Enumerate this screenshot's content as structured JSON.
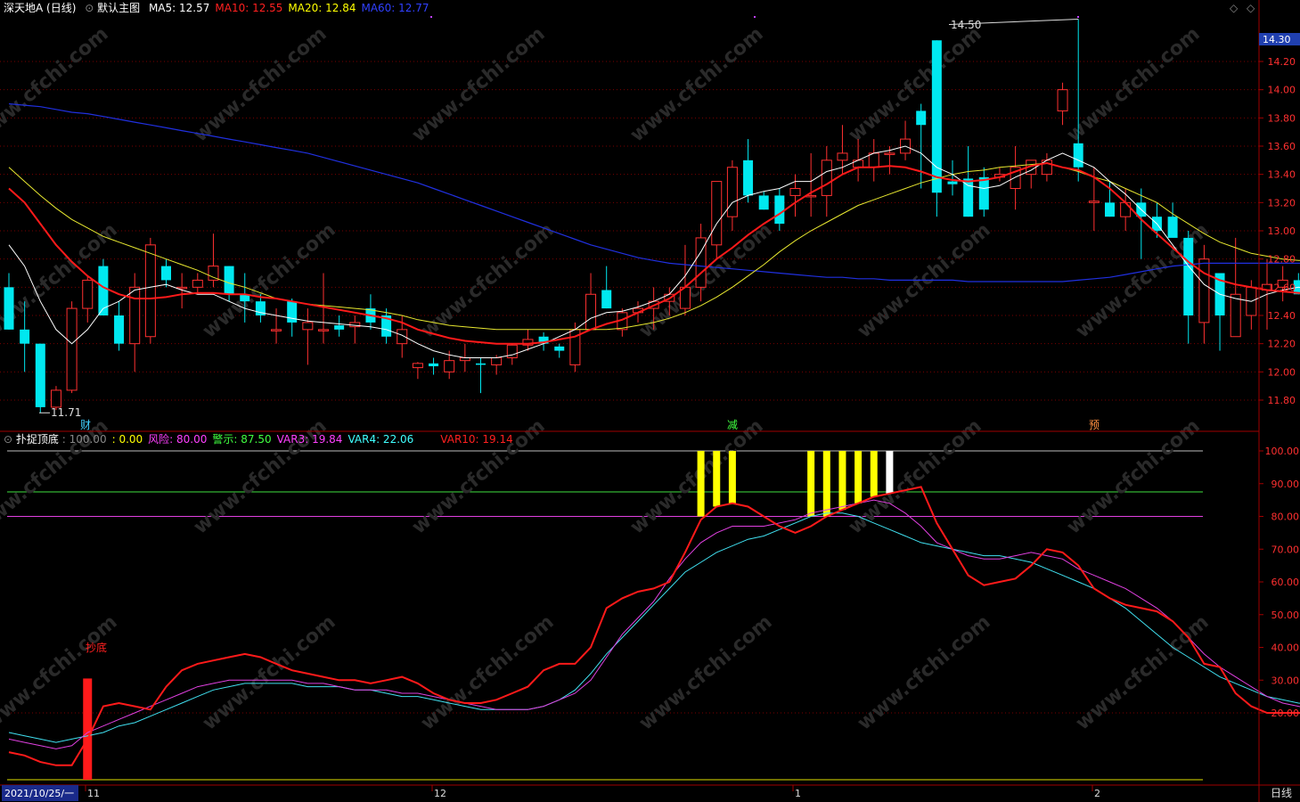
{
  "header": {
    "title": "深天地A (日线)",
    "main_chart_label": "默认主图",
    "ma": [
      {
        "label": "MA5: 12.57",
        "color": "#ffffff"
      },
      {
        "label": "MA10: 12.55",
        "color": "#ff2020"
      },
      {
        "label": "MA20: 12.84",
        "color": "#ffff00"
      },
      {
        "label": "MA60: 12.77",
        "color": "#3040ff"
      }
    ]
  },
  "sub_header": {
    "title": "扑捉顶底",
    "items": [
      {
        "label": ": 100.00",
        "color": "#888888"
      },
      {
        "label": ": 0.00",
        "color": "#ffff00"
      },
      {
        "label": "风险: 80.00",
        "color": "#ff40ff"
      },
      {
        "label": "警示: 87.50",
        "color": "#40ff40"
      },
      {
        "label": "VAR3: 19.84",
        "color": "#ff40ff"
      },
      {
        "label": "VAR4: 22.06",
        "color": "#40ffff"
      },
      {
        "label": "VAR10: 19.14",
        "color": "#ff2020"
      }
    ]
  },
  "price_axis": {
    "ticks": [
      "14.20",
      "14.00",
      "13.80",
      "13.60",
      "13.40",
      "13.20",
      "13.00",
      "12.80",
      "12.60",
      "12.40",
      "12.20",
      "12.00",
      "11.80"
    ],
    "current": "14.30"
  },
  "ind_axis": {
    "ticks": [
      "100.00",
      "90.00",
      "80.00",
      "70.00",
      "60.00",
      "50.00",
      "40.00",
      "30.00",
      "20.00"
    ]
  },
  "markers": {
    "high_label": "14.50",
    "low_label": "11.71",
    "cai": "财",
    "jian": "减",
    "yu": "预",
    "chaodi": "抄底"
  },
  "date_axis": {
    "start": "2021/10/25/一",
    "labels": [
      "11",
      "12",
      "1",
      "2"
    ],
    "period": "日线"
  },
  "watermark": "www.cfchi.com",
  "colors": {
    "up": "#ff3030",
    "down": "#00e8f0",
    "bg": "#000000",
    "grid": "#7a0000"
  },
  "chart_data": {
    "type": "candlestick",
    "candles": [
      [
        12.6,
        12.7,
        12.3,
        12.3
      ],
      [
        12.3,
        12.5,
        12.0,
        12.2
      ],
      [
        12.2,
        12.2,
        11.71,
        11.75
      ],
      [
        11.75,
        11.9,
        11.73,
        11.87
      ],
      [
        11.87,
        12.5,
        11.85,
        12.45
      ],
      [
        12.45,
        12.68,
        12.35,
        12.65
      ],
      [
        12.75,
        12.8,
        12.45,
        12.4
      ],
      [
        12.4,
        12.5,
        12.15,
        12.2
      ],
      [
        12.2,
        12.7,
        12.0,
        12.6
      ],
      [
        12.25,
        12.95,
        12.2,
        12.9
      ],
      [
        12.75,
        12.8,
        12.6,
        12.65
      ],
      [
        12.6,
        12.7,
        12.45,
        12.6
      ],
      [
        12.6,
        12.7,
        12.55,
        12.65
      ],
      [
        12.65,
        12.98,
        12.6,
        12.75
      ],
      [
        12.75,
        12.75,
        12.5,
        12.55
      ],
      [
        12.55,
        12.7,
        12.35,
        12.5
      ],
      [
        12.5,
        12.55,
        12.35,
        12.4
      ],
      [
        12.3,
        12.45,
        12.2,
        12.3
      ],
      [
        12.5,
        12.52,
        12.25,
        12.35
      ],
      [
        12.3,
        12.45,
        12.05,
        12.35
      ],
      [
        12.3,
        12.7,
        12.2,
        12.3
      ],
      [
        12.33,
        12.4,
        12.25,
        12.3
      ],
      [
        12.32,
        12.4,
        12.2,
        12.35
      ],
      [
        12.45,
        12.55,
        12.3,
        12.35
      ],
      [
        12.4,
        12.45,
        12.2,
        12.25
      ],
      [
        12.2,
        12.4,
        12.1,
        12.3
      ],
      [
        12.03,
        12.07,
        11.95,
        12.06
      ],
      [
        12.06,
        12.1,
        11.98,
        12.04
      ],
      [
        12.0,
        12.15,
        11.95,
        12.08
      ],
      [
        12.08,
        12.2,
        12.0,
        12.1
      ],
      [
        12.06,
        12.1,
        11.85,
        12.05
      ],
      [
        12.05,
        12.12,
        11.98,
        12.1
      ],
      [
        12.1,
        12.2,
        12.05,
        12.19
      ],
      [
        12.19,
        12.3,
        12.15,
        12.23
      ],
      [
        12.25,
        12.28,
        12.15,
        12.2
      ],
      [
        12.18,
        12.2,
        12.1,
        12.15
      ],
      [
        12.05,
        12.35,
        12.0,
        12.3
      ],
      [
        12.3,
        12.7,
        12.3,
        12.55
      ],
      [
        12.58,
        12.75,
        12.45,
        12.45
      ],
      [
        12.3,
        12.45,
        12.25,
        12.42
      ],
      [
        12.42,
        12.5,
        12.35,
        12.45
      ],
      [
        12.45,
        12.6,
        12.3,
        12.5
      ],
      [
        12.5,
        12.6,
        12.4,
        12.55
      ],
      [
        12.45,
        12.9,
        12.4,
        12.6
      ],
      [
        12.6,
        13.05,
        12.5,
        12.95
      ],
      [
        12.9,
        13.25,
        12.8,
        13.35
      ],
      [
        13.1,
        13.5,
        13.0,
        13.45
      ],
      [
        13.5,
        13.65,
        13.2,
        13.25
      ],
      [
        13.25,
        13.28,
        13.15,
        13.15
      ],
      [
        13.25,
        13.3,
        13.0,
        13.05
      ],
      [
        13.25,
        13.4,
        13.1,
        13.3
      ],
      [
        13.25,
        13.55,
        13.1,
        13.25
      ],
      [
        13.25,
        13.6,
        13.1,
        13.5
      ],
      [
        13.5,
        13.75,
        13.4,
        13.55
      ],
      [
        13.45,
        13.65,
        13.35,
        13.5
      ],
      [
        13.45,
        13.65,
        13.35,
        13.55
      ],
      [
        13.55,
        13.6,
        13.4,
        13.55
      ],
      [
        13.55,
        13.78,
        13.5,
        13.65
      ],
      [
        13.85,
        13.9,
        13.3,
        13.75
      ],
      [
        14.35,
        14.35,
        13.1,
        13.27
      ],
      [
        13.35,
        13.5,
        13.25,
        13.33
      ],
      [
        13.37,
        13.6,
        13.1,
        13.1
      ],
      [
        13.38,
        13.45,
        13.1,
        13.15
      ],
      [
        13.38,
        13.45,
        13.35,
        13.4
      ],
      [
        13.3,
        13.6,
        13.15,
        13.45
      ],
      [
        13.4,
        13.5,
        13.3,
        13.5
      ],
      [
        13.4,
        13.55,
        13.35,
        13.5
      ],
      [
        13.85,
        14.05,
        13.75,
        14.0
      ],
      [
        13.62,
        14.5,
        13.35,
        13.45
      ],
      [
        13.2,
        13.45,
        13.0,
        13.21
      ],
      [
        13.2,
        13.35,
        13.1,
        13.1
      ],
      [
        13.1,
        13.3,
        13.0,
        13.2
      ],
      [
        13.2,
        13.3,
        12.8,
        13.1
      ],
      [
        13.1,
        13.2,
        12.95,
        13.0
      ],
      [
        13.1,
        13.2,
        13.0,
        12.95
      ],
      [
        12.95,
        13.0,
        12.2,
        12.4
      ],
      [
        12.35,
        12.9,
        12.2,
        12.8
      ],
      [
        12.7,
        12.7,
        12.15,
        12.4
      ],
      [
        12.25,
        12.95,
        12.25,
        12.55
      ],
      [
        12.4,
        12.65,
        12.3,
        12.6
      ],
      [
        12.58,
        12.8,
        12.3,
        12.62
      ],
      [
        12.6,
        12.75,
        12.5,
        12.65
      ],
      [
        12.65,
        12.7,
        12.55,
        12.55
      ],
      [
        12.55,
        12.6,
        12.45,
        12.6
      ],
      [
        12.45,
        12.65,
        12.4,
        12.55
      ],
      [
        12.55,
        12.7,
        12.45,
        12.5
      ],
      [
        12.55,
        12.65,
        12.45,
        12.65
      ]
    ],
    "ma5": [
      12.9,
      12.75,
      12.5,
      12.3,
      12.2,
      12.3,
      12.45,
      12.5,
      12.58,
      12.6,
      12.62,
      12.58,
      12.55,
      12.55,
      12.5,
      12.45,
      12.42,
      12.4,
      12.38,
      12.36,
      12.35,
      12.34,
      12.33,
      12.32,
      12.3,
      12.26,
      12.2,
      12.15,
      12.12,
      12.1,
      12.1,
      12.1,
      12.12,
      12.16,
      12.2,
      12.25,
      12.3,
      12.38,
      12.42,
      12.43,
      12.46,
      12.5,
      12.55,
      12.68,
      12.85,
      13.05,
      13.2,
      13.25,
      13.28,
      13.3,
      13.35,
      13.35,
      13.42,
      13.45,
      13.5,
      13.55,
      13.57,
      13.6,
      13.55,
      13.45,
      13.4,
      13.32,
      13.3,
      13.32,
      13.38,
      13.43,
      13.5,
      13.55,
      13.5,
      13.45,
      13.35,
      13.26,
      13.15,
      13.05,
      12.9,
      12.75,
      12.62,
      12.55,
      12.52,
      12.5,
      12.55,
      12.58,
      12.6,
      12.58,
      12.58,
      12.57,
      12.57
    ],
    "ma10": [
      13.3,
      13.2,
      13.05,
      12.9,
      12.78,
      12.68,
      12.6,
      12.55,
      12.52,
      12.52,
      12.53,
      12.55,
      12.56,
      12.56,
      12.55,
      12.55,
      12.53,
      12.52,
      12.5,
      12.48,
      12.46,
      12.44,
      12.42,
      12.4,
      12.38,
      12.35,
      12.3,
      12.27,
      12.24,
      12.22,
      12.21,
      12.2,
      12.2,
      12.2,
      12.21,
      12.23,
      12.25,
      12.3,
      12.34,
      12.37,
      12.42,
      12.47,
      12.52,
      12.6,
      12.7,
      12.8,
      12.88,
      12.97,
      13.05,
      13.12,
      13.2,
      13.27,
      13.33,
      13.4,
      13.45,
      13.45,
      13.46,
      13.45,
      13.42,
      13.38,
      13.36,
      13.35,
      13.36,
      13.38,
      13.42,
      13.46,
      13.48,
      13.45,
      13.43,
      13.38,
      13.3,
      13.2,
      13.08,
      12.98,
      12.88,
      12.78,
      12.7,
      12.65,
      12.62,
      12.6,
      12.58,
      12.57,
      12.56,
      12.55,
      12.55,
      12.55,
      12.55
    ],
    "ma20": [
      13.45,
      13.35,
      13.25,
      13.16,
      13.08,
      13.02,
      12.96,
      12.92,
      12.88,
      12.84,
      12.8,
      12.76,
      12.72,
      12.67,
      12.63,
      12.6,
      12.56,
      12.52,
      12.5,
      12.48,
      12.47,
      12.46,
      12.45,
      12.44,
      12.42,
      12.4,
      12.37,
      12.35,
      12.33,
      12.32,
      12.31,
      12.3,
      12.3,
      12.3,
      12.3,
      12.3,
      12.3,
      12.3,
      12.3,
      12.31,
      12.33,
      12.35,
      12.38,
      12.42,
      12.47,
      12.53,
      12.6,
      12.68,
      12.76,
      12.85,
      12.93,
      13.0,
      13.06,
      13.12,
      13.18,
      13.22,
      13.26,
      13.3,
      13.34,
      13.37,
      13.4,
      13.42,
      13.43,
      13.45,
      13.46,
      13.47,
      13.48,
      13.45,
      13.42,
      13.38,
      13.35,
      13.3,
      13.25,
      13.2,
      13.12,
      13.05,
      12.98,
      12.92,
      12.88,
      12.84,
      12.82,
      12.8,
      12.79,
      12.79,
      12.78,
      12.8,
      12.84
    ],
    "ma60": [
      13.9,
      13.89,
      13.88,
      13.86,
      13.84,
      13.83,
      13.81,
      13.79,
      13.77,
      13.75,
      13.73,
      13.71,
      13.69,
      13.67,
      13.65,
      13.63,
      13.61,
      13.59,
      13.57,
      13.55,
      13.52,
      13.49,
      13.46,
      13.43,
      13.4,
      13.37,
      13.34,
      13.3,
      13.26,
      13.22,
      13.18,
      13.14,
      13.1,
      13.06,
      13.02,
      12.98,
      12.94,
      12.9,
      12.87,
      12.84,
      12.81,
      12.79,
      12.77,
      12.76,
      12.75,
      12.74,
      12.73,
      12.72,
      12.71,
      12.7,
      12.69,
      12.68,
      12.67,
      12.67,
      12.66,
      12.66,
      12.65,
      12.65,
      12.65,
      12.65,
      12.65,
      12.64,
      12.64,
      12.64,
      12.64,
      12.64,
      12.64,
      12.64,
      12.65,
      12.66,
      12.67,
      12.69,
      12.71,
      12.73,
      12.75,
      12.76,
      12.77,
      12.77,
      12.77,
      12.77,
      12.77,
      12.77,
      12.77,
      12.77,
      12.77,
      12.77,
      12.77
    ],
    "var10": [
      8,
      7,
      5,
      4,
      4,
      12,
      22,
      23,
      22,
      21,
      28,
      33,
      35,
      36,
      37,
      38,
      37,
      35,
      33,
      32,
      31,
      30,
      30,
      29,
      30,
      31,
      29,
      26,
      24,
      23,
      23,
      24,
      26,
      28,
      33,
      35,
      35,
      40,
      52,
      55,
      57,
      58,
      60,
      69,
      79,
      83,
      84,
      83,
      80,
      77,
      75,
      77,
      80,
      82,
      84,
      86,
      87,
      88,
      89,
      78,
      70,
      62,
      59,
      60,
      61,
      65,
      70,
      69,
      65,
      58,
      55,
      53,
      52,
      51,
      48,
      43,
      35,
      34,
      26,
      22,
      20,
      20,
      20,
      19.5,
      19,
      18.5,
      18.5,
      19.14
    ],
    "var3": [
      12,
      11,
      10,
      9,
      10,
      14,
      16,
      18,
      20,
      22,
      24,
      26,
      28,
      29,
      30,
      30,
      30,
      30,
      30,
      29,
      29,
      28,
      27,
      27,
      27,
      26,
      26,
      25,
      24,
      23,
      22,
      21,
      21,
      21,
      22,
      24,
      26,
      30,
      37,
      44,
      49,
      54,
      61,
      67,
      72,
      75,
      77,
      77,
      77,
      78,
      79,
      81,
      82,
      83,
      84,
      85,
      84,
      81,
      77,
      72,
      70,
      68,
      67,
      67,
      68,
      69,
      68,
      67,
      64,
      62,
      60,
      58,
      55,
      52,
      48,
      43,
      38,
      34,
      31,
      28,
      25,
      23,
      22,
      21,
      20.5,
      20,
      19.84
    ],
    "var4": [
      14,
      13,
      12,
      11,
      12,
      13,
      14,
      16,
      17,
      19,
      21,
      23,
      25,
      27,
      28,
      29,
      29,
      29,
      29,
      28,
      28,
      28,
      27,
      27,
      26,
      25,
      25,
      24,
      23,
      22,
      21,
      21,
      21,
      21,
      22,
      24,
      27,
      32,
      38,
      43,
      48,
      53,
      58,
      63,
      66,
      69,
      71,
      73,
      74,
      76,
      78,
      80,
      81,
      81,
      80,
      78,
      76,
      74,
      72,
      71,
      70,
      69,
      68,
      68,
      67,
      66,
      64,
      62,
      60,
      58,
      55,
      52,
      48,
      44,
      40,
      37,
      34,
      31,
      29,
      27,
      25,
      24,
      23,
      22.5,
      22.2,
      22.06
    ],
    "danger": 80,
    "warning": 87.5,
    "top_signals_yellow": [
      44,
      45,
      46,
      51,
      52,
      53,
      54,
      55
    ],
    "top_signals_white": [
      56
    ],
    "bottom_signal_index": 5
  }
}
